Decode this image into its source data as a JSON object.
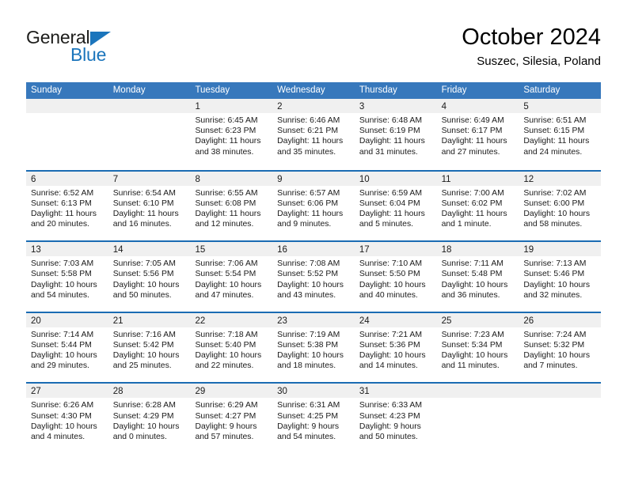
{
  "logo": {
    "word1": "General",
    "word2": "Blue",
    "triangle_color": "#1b75bc"
  },
  "header": {
    "month_title": "October 2024",
    "location": "Suszec, Silesia, Poland"
  },
  "theme": {
    "header_blue": "#3778bc",
    "row_divider_blue": "#1b6cb3",
    "day_band_gray": "#f0f0f0"
  },
  "weekdays": [
    "Sunday",
    "Monday",
    "Tuesday",
    "Wednesday",
    "Thursday",
    "Friday",
    "Saturday"
  ],
  "weeks": [
    [
      {
        "day": "",
        "empty": true
      },
      {
        "day": "",
        "empty": true
      },
      {
        "day": "1",
        "sunrise": "Sunrise: 6:45 AM",
        "sunset": "Sunset: 6:23 PM",
        "daylight": "Daylight: 11 hours and 38 minutes."
      },
      {
        "day": "2",
        "sunrise": "Sunrise: 6:46 AM",
        "sunset": "Sunset: 6:21 PM",
        "daylight": "Daylight: 11 hours and 35 minutes."
      },
      {
        "day": "3",
        "sunrise": "Sunrise: 6:48 AM",
        "sunset": "Sunset: 6:19 PM",
        "daylight": "Daylight: 11 hours and 31 minutes."
      },
      {
        "day": "4",
        "sunrise": "Sunrise: 6:49 AM",
        "sunset": "Sunset: 6:17 PM",
        "daylight": "Daylight: 11 hours and 27 minutes."
      },
      {
        "day": "5",
        "sunrise": "Sunrise: 6:51 AM",
        "sunset": "Sunset: 6:15 PM",
        "daylight": "Daylight: 11 hours and 24 minutes."
      }
    ],
    [
      {
        "day": "6",
        "sunrise": "Sunrise: 6:52 AM",
        "sunset": "Sunset: 6:13 PM",
        "daylight": "Daylight: 11 hours and 20 minutes."
      },
      {
        "day": "7",
        "sunrise": "Sunrise: 6:54 AM",
        "sunset": "Sunset: 6:10 PM",
        "daylight": "Daylight: 11 hours and 16 minutes."
      },
      {
        "day": "8",
        "sunrise": "Sunrise: 6:55 AM",
        "sunset": "Sunset: 6:08 PM",
        "daylight": "Daylight: 11 hours and 12 minutes."
      },
      {
        "day": "9",
        "sunrise": "Sunrise: 6:57 AM",
        "sunset": "Sunset: 6:06 PM",
        "daylight": "Daylight: 11 hours and 9 minutes."
      },
      {
        "day": "10",
        "sunrise": "Sunrise: 6:59 AM",
        "sunset": "Sunset: 6:04 PM",
        "daylight": "Daylight: 11 hours and 5 minutes."
      },
      {
        "day": "11",
        "sunrise": "Sunrise: 7:00 AM",
        "sunset": "Sunset: 6:02 PM",
        "daylight": "Daylight: 11 hours and 1 minute."
      },
      {
        "day": "12",
        "sunrise": "Sunrise: 7:02 AM",
        "sunset": "Sunset: 6:00 PM",
        "daylight": "Daylight: 10 hours and 58 minutes."
      }
    ],
    [
      {
        "day": "13",
        "sunrise": "Sunrise: 7:03 AM",
        "sunset": "Sunset: 5:58 PM",
        "daylight": "Daylight: 10 hours and 54 minutes."
      },
      {
        "day": "14",
        "sunrise": "Sunrise: 7:05 AM",
        "sunset": "Sunset: 5:56 PM",
        "daylight": "Daylight: 10 hours and 50 minutes."
      },
      {
        "day": "15",
        "sunrise": "Sunrise: 7:06 AM",
        "sunset": "Sunset: 5:54 PM",
        "daylight": "Daylight: 10 hours and 47 minutes."
      },
      {
        "day": "16",
        "sunrise": "Sunrise: 7:08 AM",
        "sunset": "Sunset: 5:52 PM",
        "daylight": "Daylight: 10 hours and 43 minutes."
      },
      {
        "day": "17",
        "sunrise": "Sunrise: 7:10 AM",
        "sunset": "Sunset: 5:50 PM",
        "daylight": "Daylight: 10 hours and 40 minutes."
      },
      {
        "day": "18",
        "sunrise": "Sunrise: 7:11 AM",
        "sunset": "Sunset: 5:48 PM",
        "daylight": "Daylight: 10 hours and 36 minutes."
      },
      {
        "day": "19",
        "sunrise": "Sunrise: 7:13 AM",
        "sunset": "Sunset: 5:46 PM",
        "daylight": "Daylight: 10 hours and 32 minutes."
      }
    ],
    [
      {
        "day": "20",
        "sunrise": "Sunrise: 7:14 AM",
        "sunset": "Sunset: 5:44 PM",
        "daylight": "Daylight: 10 hours and 29 minutes."
      },
      {
        "day": "21",
        "sunrise": "Sunrise: 7:16 AM",
        "sunset": "Sunset: 5:42 PM",
        "daylight": "Daylight: 10 hours and 25 minutes."
      },
      {
        "day": "22",
        "sunrise": "Sunrise: 7:18 AM",
        "sunset": "Sunset: 5:40 PM",
        "daylight": "Daylight: 10 hours and 22 minutes."
      },
      {
        "day": "23",
        "sunrise": "Sunrise: 7:19 AM",
        "sunset": "Sunset: 5:38 PM",
        "daylight": "Daylight: 10 hours and 18 minutes."
      },
      {
        "day": "24",
        "sunrise": "Sunrise: 7:21 AM",
        "sunset": "Sunset: 5:36 PM",
        "daylight": "Daylight: 10 hours and 14 minutes."
      },
      {
        "day": "25",
        "sunrise": "Sunrise: 7:23 AM",
        "sunset": "Sunset: 5:34 PM",
        "daylight": "Daylight: 10 hours and 11 minutes."
      },
      {
        "day": "26",
        "sunrise": "Sunrise: 7:24 AM",
        "sunset": "Sunset: 5:32 PM",
        "daylight": "Daylight: 10 hours and 7 minutes."
      }
    ],
    [
      {
        "day": "27",
        "sunrise": "Sunrise: 6:26 AM",
        "sunset": "Sunset: 4:30 PM",
        "daylight": "Daylight: 10 hours and 4 minutes."
      },
      {
        "day": "28",
        "sunrise": "Sunrise: 6:28 AM",
        "sunset": "Sunset: 4:29 PM",
        "daylight": "Daylight: 10 hours and 0 minutes."
      },
      {
        "day": "29",
        "sunrise": "Sunrise: 6:29 AM",
        "sunset": "Sunset: 4:27 PM",
        "daylight": "Daylight: 9 hours and 57 minutes."
      },
      {
        "day": "30",
        "sunrise": "Sunrise: 6:31 AM",
        "sunset": "Sunset: 4:25 PM",
        "daylight": "Daylight: 9 hours and 54 minutes."
      },
      {
        "day": "31",
        "sunrise": "Sunrise: 6:33 AM",
        "sunset": "Sunset: 4:23 PM",
        "daylight": "Daylight: 9 hours and 50 minutes."
      },
      {
        "day": "",
        "empty": true
      },
      {
        "day": "",
        "empty": true
      }
    ]
  ]
}
